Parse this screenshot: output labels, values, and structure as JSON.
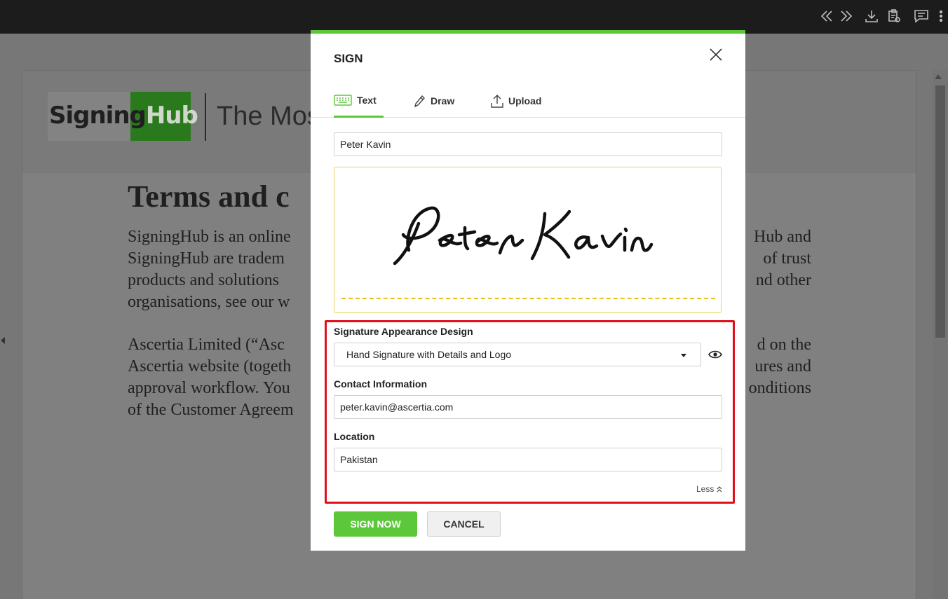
{
  "toolbar": {
    "icons": [
      "double-chevron-left-icon",
      "double-chevron-right-icon",
      "download-icon",
      "clipboard-icon",
      "comment-icon",
      "more-vertical-icon"
    ]
  },
  "document": {
    "logo_text_a": "Signing",
    "logo_text_b": "Hub",
    "tagline": "The Mos",
    "title": "Terms and c",
    "paragraph1": [
      [
        "SigningHub is an online",
        "Hub and"
      ],
      [
        "SigningHub are tradem",
        "of trust"
      ],
      [
        "products and solutions",
        "nd other"
      ],
      [
        "organisations, see our w",
        ""
      ]
    ],
    "paragraph2": [
      [
        "Ascertia Limited (“Asc",
        "d on the"
      ],
      [
        "Ascertia website (togeth",
        "ures and"
      ],
      [
        "approval workflow. You",
        "onditions"
      ],
      [
        "of the Customer Agreem",
        ""
      ]
    ]
  },
  "modal": {
    "title": "SIGN",
    "tabs": [
      {
        "label": "Text",
        "icon": "keyboard-icon",
        "active": true
      },
      {
        "label": "Draw",
        "icon": "pen-icon",
        "active": false
      },
      {
        "label": "Upload",
        "icon": "upload-icon",
        "active": false
      }
    ],
    "name_value": "Peter Kavin",
    "signature_text": "Peter Kavin",
    "appearance_label": "Signature Appearance Design",
    "appearance_value": "Hand Signature with Details and Logo",
    "contact_label": "Contact Information",
    "contact_value": "peter.kavin@ascertia.com",
    "location_label": "Location",
    "location_value": "Pakistan",
    "less_label": "Less",
    "sign_button": "SIGN NOW",
    "cancel_button": "CANCEL"
  },
  "colors": {
    "accent": "#5cc73a",
    "highlight": "#e0101a",
    "signature_baseline": "#e6c21e"
  }
}
